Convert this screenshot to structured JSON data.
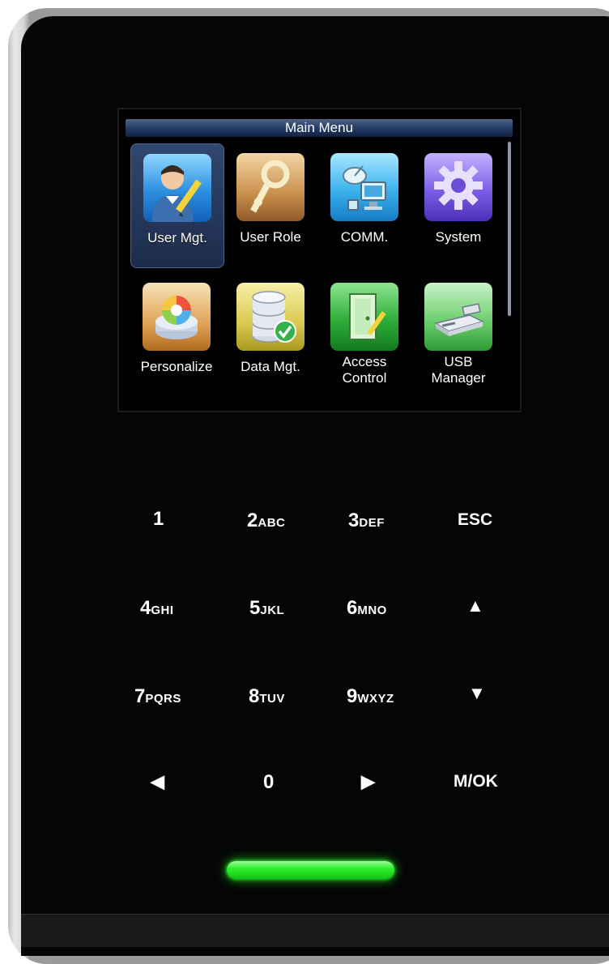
{
  "screen": {
    "title": "Main Menu",
    "menu_items": [
      {
        "label": "User Mgt.",
        "icon": "user-management-icon",
        "selected": true
      },
      {
        "label": "User Role",
        "icon": "key-icon",
        "selected": false
      },
      {
        "label": "COMM.",
        "icon": "network-icon",
        "selected": false
      },
      {
        "label": "System",
        "icon": "gear-icon",
        "selected": false
      },
      {
        "label": "Personalize",
        "icon": "personalize-icon",
        "selected": false
      },
      {
        "label": "Data Mgt.",
        "icon": "database-icon",
        "selected": false
      },
      {
        "label": "Access Control",
        "label_lines": [
          "Access",
          "Control"
        ],
        "icon": "door-icon",
        "selected": false
      },
      {
        "label": "USB Manager",
        "label_lines": [
          "USB",
          "Manager"
        ],
        "icon": "usb-drive-icon",
        "selected": false
      }
    ]
  },
  "keypad": {
    "k1": {
      "main": "1",
      "sub": ""
    },
    "k2": {
      "main": "2",
      "sub": "ABC"
    },
    "k3": {
      "main": "3",
      "sub": "DEF"
    },
    "esc": "ESC",
    "k4": {
      "main": "4",
      "sub": "GHI"
    },
    "k5": {
      "main": "5",
      "sub": "JKL"
    },
    "k6": {
      "main": "6",
      "sub": "MNO"
    },
    "up": "▲",
    "k7": {
      "main": "7",
      "sub": "PQRS"
    },
    "k8": {
      "main": "8",
      "sub": "TUV"
    },
    "k9": {
      "main": "9",
      "sub": "WXYZ"
    },
    "down": "▼",
    "left": "◀",
    "k0": {
      "main": "0",
      "sub": ""
    },
    "right": "▶",
    "ok": "M/OK"
  },
  "colors": {
    "title_bar": "#27406a",
    "selection": "#32476e",
    "led": "#2ef02e",
    "body": "#050505"
  }
}
